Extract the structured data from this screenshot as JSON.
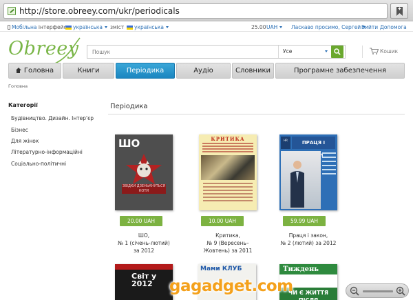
{
  "browser": {
    "url": "http://store.obreey.com/ukr/periodicals"
  },
  "topbar": {
    "mobile_label": "Мобільна",
    "interface_label": "інтерфейс",
    "interface_lang": "українська",
    "content_label": "зміст",
    "content_lang": "українська",
    "balance": "25.00",
    "currency": "UAH",
    "welcome": "Ласкаво просимо, Сергей",
    "logout": "Вийти",
    "help": "Допомога"
  },
  "header": {
    "logo": "Obreey",
    "search_placeholder": "Пошук",
    "search_category": "Усе",
    "cart_label": "Кошик"
  },
  "tabs": [
    {
      "label": "Головна"
    },
    {
      "label": "Книги"
    },
    {
      "label": "Періодика"
    },
    {
      "label": "Аудіо"
    },
    {
      "label": "Словники"
    },
    {
      "label": "Програмне забезпечення"
    }
  ],
  "breadcrumb": "Головна",
  "sidebar": {
    "title": "Категорії",
    "items": [
      {
        "label": "Будівництво. Дизайн. Інтер'єр"
      },
      {
        "label": "Бізнес"
      },
      {
        "label": "Для жінок"
      },
      {
        "label": "Літературно-інформаційні"
      },
      {
        "label": "Соціально-політичні"
      }
    ]
  },
  "main": {
    "title": "Періодика",
    "products": [
      {
        "price": "20.00 UAH",
        "title_line1": "ШО,",
        "title_line2": "№ 1 (січень-лютий)",
        "title_line3": "за 2012",
        "cover_head": "ШО",
        "cover_band": "ЗВІДКИ ДЗЕНЬКНУТЬСЯ КОТИ"
      },
      {
        "price": "10.00 UAH",
        "title_line1": "Критика,",
        "title_line2": "№ 9 (Вересень–",
        "title_line3": "Жовтень) за 2011",
        "cover_head": "КРИТИКА"
      },
      {
        "price": "59.99 UAH",
        "title_line1": "Праця і закон,",
        "title_line2": "№ 2 (лютий) за 2012",
        "title_line3": "",
        "cover_head": "ПРАЦЯ І ЗАКОН",
        "cover_tag": "HR"
      }
    ],
    "bottom_covers": [
      {
        "head": "Світ у 2012"
      },
      {
        "head": "Мами КЛУБ"
      },
      {
        "head": "Тиждень",
        "band": "ЧИ Є ЖИТТЯ ПІСЛЯ"
      }
    ]
  },
  "watermark": "gagadget.com",
  "colors": {
    "accent_blue": "#1b86c0",
    "price_green": "#7cb241",
    "logo_green": "#7ab648",
    "link_blue": "#2a6fb5"
  }
}
